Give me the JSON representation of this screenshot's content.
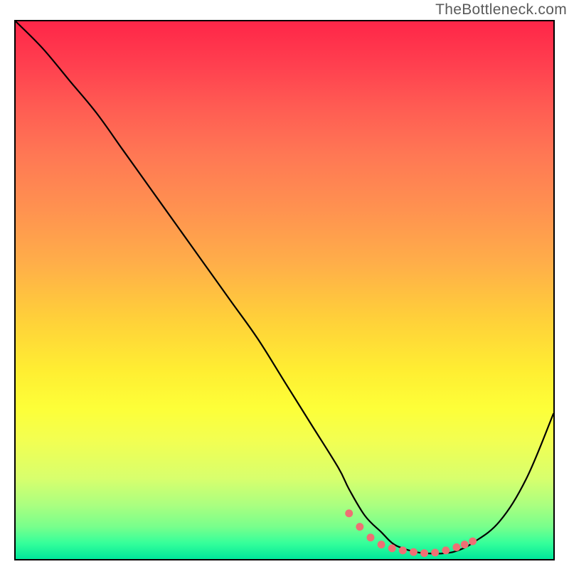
{
  "watermark": "TheBottleneck.com",
  "chart_data": {
    "type": "line",
    "title": "",
    "xlabel": "",
    "ylabel": "",
    "xlim": [
      0,
      100
    ],
    "ylim": [
      0,
      100
    ],
    "series": [
      {
        "name": "curve",
        "x": [
          0,
          5,
          10,
          15,
          20,
          25,
          30,
          35,
          40,
          45,
          50,
          55,
          60,
          62,
          65,
          68,
          70,
          72,
          75,
          78,
          80,
          82,
          85,
          90,
          95,
          100
        ],
        "y": [
          100,
          95,
          89,
          83,
          76,
          69,
          62,
          55,
          48,
          41,
          33,
          25,
          17,
          13,
          8,
          5,
          3,
          2,
          1.2,
          1,
          1.1,
          1.5,
          3,
          7,
          15,
          27
        ]
      }
    ],
    "markers": {
      "name": "optimal-range",
      "color": "#ef6f74",
      "radius": 5.5,
      "x": [
        62,
        64,
        66,
        68,
        70,
        72,
        74,
        76,
        78,
        80,
        82,
        83.5,
        85
      ],
      "y": [
        8.5,
        6,
        4,
        2.7,
        2,
        1.6,
        1.3,
        1.1,
        1.2,
        1.6,
        2.2,
        2.7,
        3.3
      ]
    }
  }
}
